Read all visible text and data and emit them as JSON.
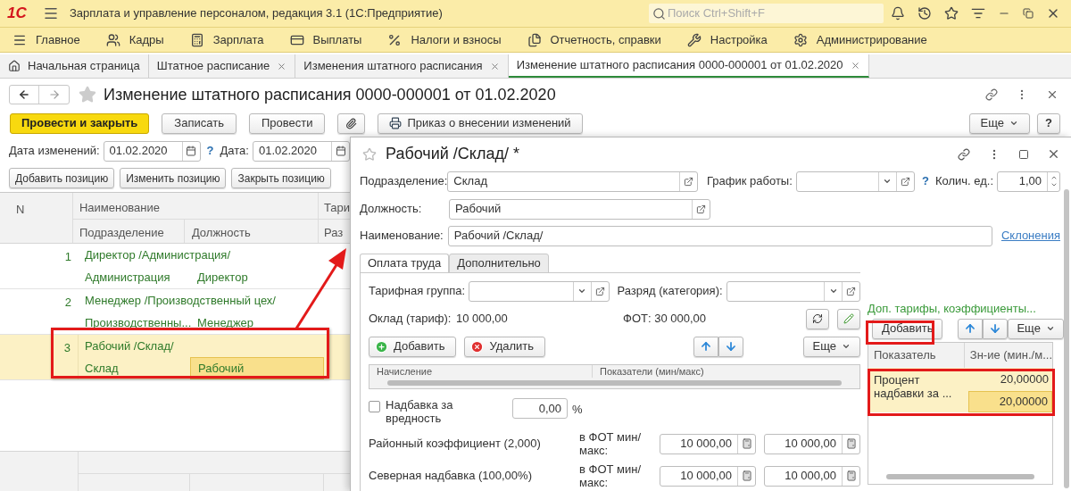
{
  "app": {
    "logo": "1С",
    "title": "Зарплата и управление персоналом, редакция 3.1  (1С:Предприятие)",
    "search_placeholder": "Поиск Ctrl+Shift+F"
  },
  "sections": [
    {
      "label": "Главное"
    },
    {
      "label": "Кадры"
    },
    {
      "label": "Зарплата"
    },
    {
      "label": "Выплаты"
    },
    {
      "label": "Налоги и взносы"
    },
    {
      "label": "Отчетность, справки"
    },
    {
      "label": "Настройка"
    },
    {
      "label": "Администрирование"
    }
  ],
  "open_tabs": [
    {
      "label": "Начальная страница",
      "selected": false,
      "closable": false
    },
    {
      "label": "Штатное расписание",
      "selected": false,
      "closable": true
    },
    {
      "label": "Изменения штатного расписания",
      "selected": false,
      "closable": true
    },
    {
      "label": "Изменение штатного расписания 0000-000001 от 01.02.2020",
      "selected": true,
      "closable": true
    }
  ],
  "form": {
    "title": "Изменение штатного расписания 0000-000001 от 01.02.2020",
    "toolbar": [
      {
        "kind": "primary",
        "label": "Провести и закрыть"
      },
      {
        "kind": "plain",
        "label": "Записать"
      },
      {
        "kind": "plain",
        "label": "Провести"
      },
      {
        "kind": "attach"
      },
      {
        "kind": "print",
        "label": "Приказ о внесении изменений"
      }
    ],
    "more": "Еще",
    "help": "?",
    "change_date_label": "Дата изменений:",
    "change_date": "01.02.2020",
    "date_help": "?",
    "date_label": "Дата:",
    "date": "01.02.2020",
    "position_buttons": [
      "Добавить позицию",
      "Изменить позицию",
      "Закрыть позицию"
    ],
    "table": {
      "header": [
        "N",
        "Наименование",
        "Тари"
      ],
      "subheader": [
        "Подразделение",
        "Должность",
        "Раз"
      ],
      "rows": [
        {
          "n": "1",
          "name": "Директор /Администрация/",
          "department": "Администрация",
          "position": "Директор",
          "selected": false
        },
        {
          "n": "2",
          "name": "Менеджер /Производственный цех/",
          "department": "Производственны...",
          "position": "Менеджер",
          "selected": false
        },
        {
          "n": "3",
          "name": "Рабочий /Склад/",
          "department": "Склад",
          "position": "Рабочий",
          "selected": true
        }
      ]
    }
  },
  "dialog": {
    "title": "Рабочий /Склад/ *",
    "department_label": "Подразделение:",
    "department": "Склад",
    "schedule_label": "График работы:",
    "schedule_help": "?",
    "units_label": "Колич. ед.:",
    "units": "1,00",
    "position_label": "Должность:",
    "position": "Рабочий",
    "name_label": "Наименование:",
    "name": "Рабочий /Склад/",
    "declension_link": "Склонения",
    "tabs": [
      {
        "label": "Оплата труда",
        "selected": true
      },
      {
        "label": "Дополнительно",
        "selected": false
      }
    ],
    "pay": {
      "tariff_group_label": "Тарифная группа:",
      "grade_label": "Разряд (категория):",
      "salary_label": "Оклад (тариф):",
      "salary": "10 000,00",
      "fot": "ФОТ: 30 000,00",
      "add": "Добавить",
      "delete": "Удалить",
      "more": "Еще",
      "columns": [
        "Начисление",
        "Показатели (мин/макс)"
      ],
      "hazard_label": "Надбавка за вредность",
      "hazard_checked": false,
      "hazard_value": "0,00",
      "hazard_unit": "%",
      "allowances": [
        {
          "label": "Районный коэффициент (2,000)",
          "fot_label": "в ФОТ мин/макс:",
          "min": "10 000,00",
          "max": "10 000,00"
        },
        {
          "label": "Северная надбавка (100,00%)",
          "fot_label": "в ФОТ мин/макс:",
          "min": "10 000,00",
          "max": "10 000,00"
        }
      ]
    },
    "extra": {
      "title": "Доп. тарифы, коэффициенты...",
      "add": "Добавить",
      "more": "Еще",
      "columns": [
        "Показатель",
        "Зн-ие (мин./м..."
      ],
      "rows": [
        {
          "indicator": "Процент надбавки за ...",
          "min": "20,00000",
          "max": "20,00000",
          "selected": true
        }
      ]
    }
  }
}
